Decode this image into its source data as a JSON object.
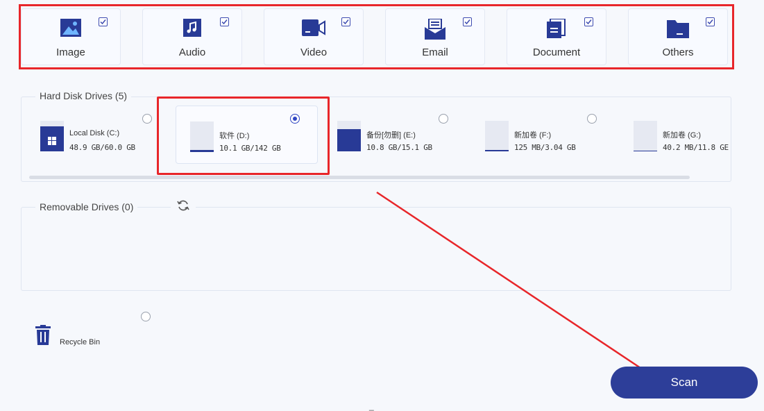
{
  "file_types": [
    {
      "label": "Image",
      "icon": "image-icon",
      "checked": true
    },
    {
      "label": "Audio",
      "icon": "audio-icon",
      "checked": true
    },
    {
      "label": "Video",
      "icon": "video-icon",
      "checked": true
    },
    {
      "label": "Email",
      "icon": "email-icon",
      "checked": true
    },
    {
      "label": "Document",
      "icon": "document-icon",
      "checked": true
    },
    {
      "label": "Others",
      "icon": "folder-icon",
      "checked": true
    }
  ],
  "hard_disk": {
    "title": "Hard Disk Drives (5)",
    "drives": [
      {
        "name": "Local Disk (C:)",
        "size": "48.9 GB/60.0 GB",
        "used_fraction": 0.82,
        "selected": false
      },
      {
        "name": "软件 (D:)",
        "size": "10.1 GB/142 GB",
        "used_fraction": 0.07,
        "selected": true
      },
      {
        "name": "备份[勿删] (E:)",
        "size": "10.8 GB/15.1 GB",
        "used_fraction": 0.72,
        "selected": false
      },
      {
        "name": "新加卷 (F:)",
        "size": "125 MB/3.04 GB",
        "used_fraction": 0.04,
        "selected": false
      },
      {
        "name": "新加卷 (G:)",
        "size": "40.2 MB/11.8 GE",
        "used_fraction": 0.01,
        "selected": false
      }
    ]
  },
  "removable": {
    "title": "Removable Drives (0)"
  },
  "recycle_bin": {
    "label": "Recycle Bin",
    "selected": false
  },
  "scan_label": "Scan",
  "page_marker": "_",
  "colors": {
    "accent": "#2d3e99",
    "highlight": "#e8262a",
    "icon": "#283a96"
  }
}
